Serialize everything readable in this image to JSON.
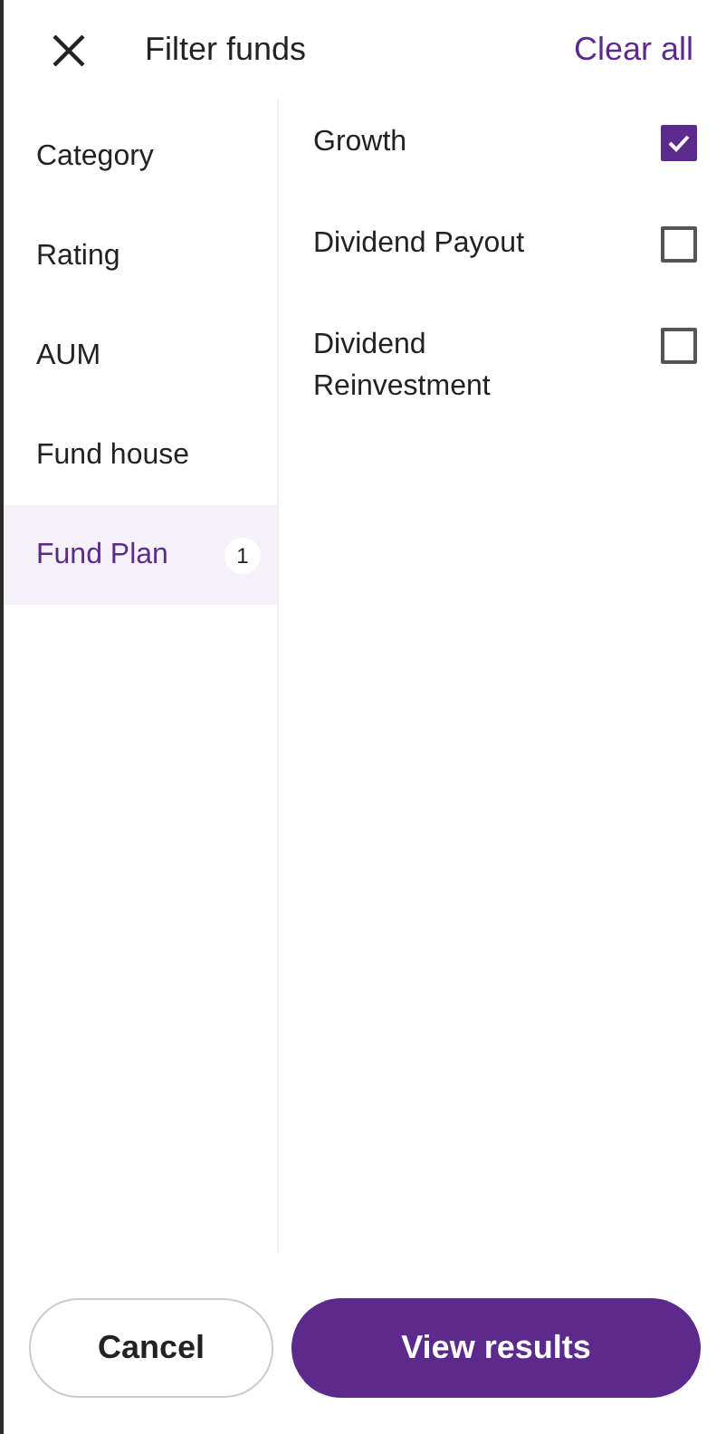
{
  "header": {
    "title": "Filter funds",
    "clear_label": "Clear all"
  },
  "categories": [
    {
      "label": "Category",
      "selected": false
    },
    {
      "label": "Rating",
      "selected": false
    },
    {
      "label": "AUM",
      "selected": false
    },
    {
      "label": "Fund house",
      "selected": false
    },
    {
      "label": "Fund Plan",
      "selected": true,
      "badge": "1"
    }
  ],
  "options": [
    {
      "label": "Growth",
      "checked": true
    },
    {
      "label": "Dividend Payout",
      "checked": false
    },
    {
      "label": "Dividend\nReinvestment",
      "checked": false
    }
  ],
  "buttons": {
    "cancel": "Cancel",
    "apply": "View results"
  }
}
